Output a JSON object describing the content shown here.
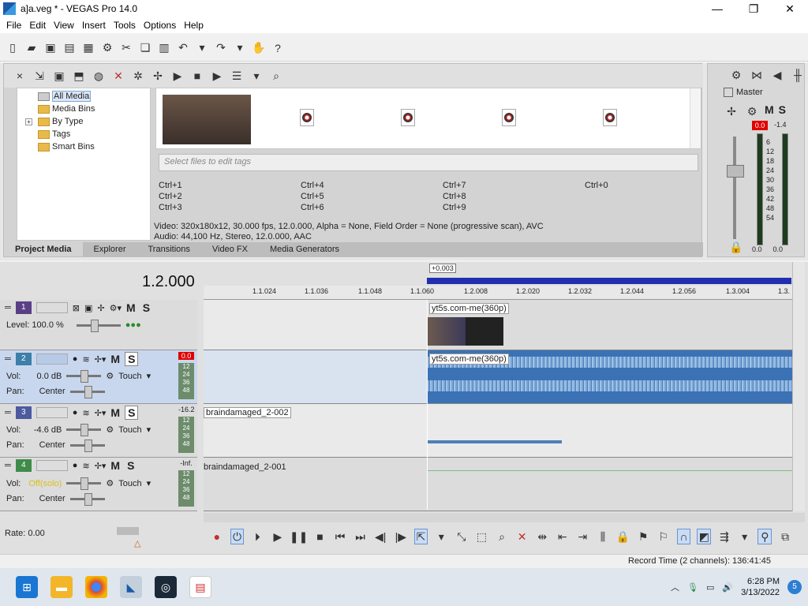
{
  "window": {
    "title": "a]a.veg * - VEGAS Pro 14.0",
    "minimize": "—",
    "maximize": "❐",
    "close": "✕"
  },
  "menu": [
    "File",
    "Edit",
    "View",
    "Insert",
    "Tools",
    "Options",
    "Help"
  ],
  "project_media": {
    "tree": [
      "All Media",
      "Media Bins",
      "By Type",
      "Tags",
      "Smart Bins"
    ],
    "tree_expand": "+",
    "tags_placeholder": "Select files to edit tags",
    "shortcuts": [
      "Ctrl+1",
      "Ctrl+4",
      "Ctrl+7",
      "Ctrl+0",
      "Ctrl+2",
      "Ctrl+5",
      "Ctrl+8",
      "",
      "Ctrl+3",
      "Ctrl+6",
      "Ctrl+9",
      ""
    ],
    "video_info": "Video: 320x180x12, 30.000 fps, 12.0.000, Alpha = None, Field Order = None (progressive scan), AVC",
    "audio_info": "Audio: 44,100 Hz, Stereo, 12.0.000, AAC",
    "tabs": [
      "Project Media",
      "Explorer",
      "Transitions",
      "Video FX",
      "Media Generators"
    ]
  },
  "master": {
    "label": "Master",
    "mute": "M",
    "solo": "S",
    "peak_left": "0.0",
    "peak_right": "-1.4",
    "scale": [
      "6",
      "12",
      "18",
      "24",
      "30",
      "36",
      "42",
      "48",
      "54"
    ],
    "bottom_left": "0.0",
    "bottom_right": "0.0",
    "fader_level": 0.82
  },
  "timeline": {
    "time": "1.2.000",
    "cursor_offset": "+0.003",
    "ruler": [
      "1.1.024",
      "1.1.036",
      "1.1.048",
      "1.1.060",
      "1.2.008",
      "1.2.020",
      "1.2.032",
      "1.2.044",
      "1.2.056",
      "1.3.004",
      "1.3."
    ],
    "tracks": [
      {
        "num": "1",
        "color": "#5b3f86",
        "mute": "M",
        "solo": "S",
        "level_label": "Level: 100.0 %",
        "clip": "yt5s.com-me(360p)"
      },
      {
        "num": "2",
        "color": "#3d7fa8",
        "mute": "M",
        "solo": "S",
        "vol_label": "Vol:",
        "vol": "0.0 dB",
        "pan_label": "Pan:",
        "pan": "Center",
        "mode": "Touch",
        "peak": "0.0",
        "meter": [
          "12",
          "24",
          "36",
          "48"
        ],
        "clip": "yt5s.com-me(360p)"
      },
      {
        "num": "3",
        "color": "#4c5aa0",
        "mute": "M",
        "solo": "S",
        "vol_label": "Vol:",
        "vol": "-4.6 dB",
        "pan_label": "Pan:",
        "pan": "Center",
        "mode": "Touch",
        "peak": "-16.2",
        "meter": [
          "12",
          "24",
          "36",
          "48"
        ],
        "clip": "braindamaged_2-002"
      },
      {
        "num": "4",
        "color": "#3f8b4a",
        "mute": "M",
        "solo": "S",
        "vol_label": "Vol:",
        "vol": "Off(solo)",
        "pan_label": "Pan:",
        "pan": "Center",
        "mode": "Touch",
        "peak": "-Inf.",
        "meter": [
          "12",
          "24",
          "36",
          "48"
        ],
        "clip": "braindamaged_2-001"
      }
    ],
    "rate": "Rate: 0.00"
  },
  "status": {
    "record_time": "Record Time (2 channels): 136:41:45"
  },
  "taskbar": {
    "time": "6:28 PM",
    "date": "3/13/2022",
    "notifications": "5"
  },
  "colors": {
    "loop_region": "#1f2fb0",
    "peak_red": "#e00000",
    "selection": "#c8d7ee"
  }
}
